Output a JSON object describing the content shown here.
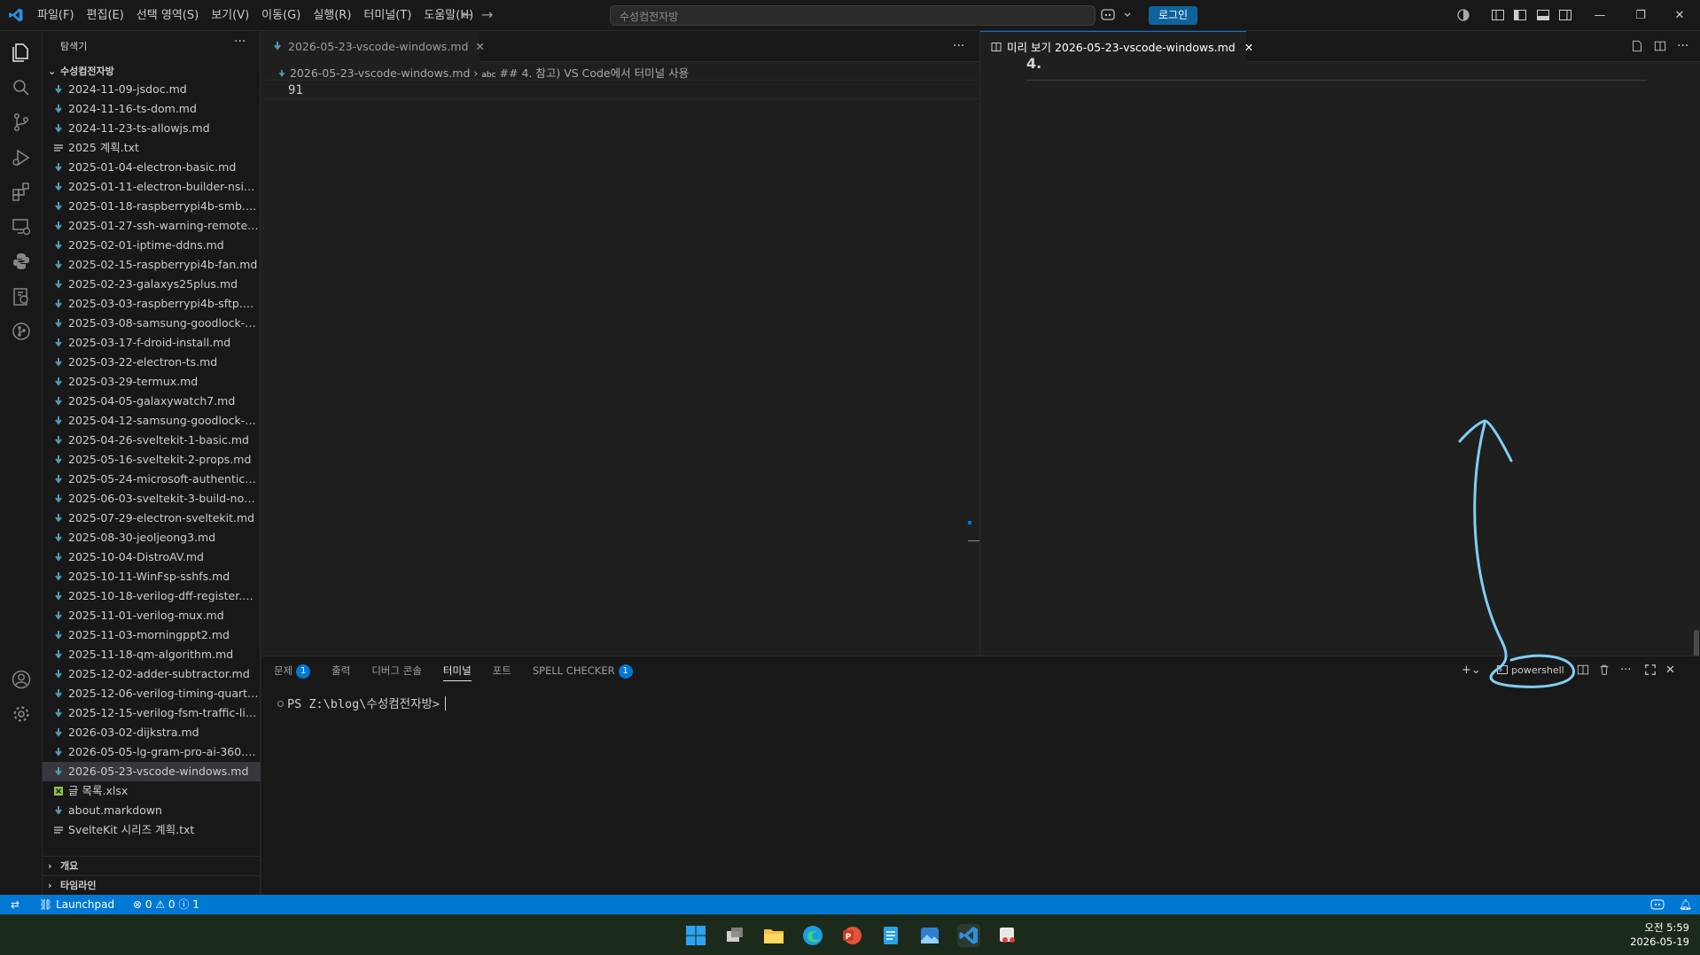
{
  "titlebar": {
    "menu": [
      "파일(F)",
      "편집(E)",
      "선택 영역(S)",
      "보기(V)",
      "이동(G)",
      "실행(R)",
      "터미널(T)",
      "도움말(H)"
    ],
    "search_placeholder": "수성컴전자방",
    "login_label": "로그인"
  },
  "sidebar": {
    "title": "탐색기",
    "folder": "수성컴전자방",
    "files": [
      {
        "name": "2024-11-09-jsdoc.md",
        "type": "md"
      },
      {
        "name": "2024-11-16-ts-dom.md",
        "type": "md"
      },
      {
        "name": "2024-11-23-ts-allowjs.md",
        "type": "md"
      },
      {
        "name": "2025 계획.txt",
        "type": "txt"
      },
      {
        "name": "2025-01-04-electron-basic.md",
        "type": "md"
      },
      {
        "name": "2025-01-11-electron-builder-nsis.md",
        "type": "md"
      },
      {
        "name": "2025-01-18-raspberrypi4b-smb.md",
        "type": "md"
      },
      {
        "name": "2025-01-27-ssh-warning-remote-h...",
        "type": "md"
      },
      {
        "name": "2025-02-01-iptime-ddns.md",
        "type": "md"
      },
      {
        "name": "2025-02-15-raspberrypi4b-fan.md",
        "type": "md"
      },
      {
        "name": "2025-02-23-galaxys25plus.md",
        "type": "md"
      },
      {
        "name": "2025-03-03-raspberrypi4b-sftp.md",
        "type": "md"
      },
      {
        "name": "2025-03-08-samsung-goodlock-mu...",
        "type": "md"
      },
      {
        "name": "2025-03-17-f-droid-install.md",
        "type": "md"
      },
      {
        "name": "2025-03-22-electron-ts.md",
        "type": "md"
      },
      {
        "name": "2025-03-29-termux.md",
        "type": "md"
      },
      {
        "name": "2025-04-05-galaxywatch7.md",
        "type": "md"
      },
      {
        "name": "2025-04-12-samsung-goodlock-ca...",
        "type": "md"
      },
      {
        "name": "2025-04-26-sveltekit-1-basic.md",
        "type": "md"
      },
      {
        "name": "2025-05-16-sveltekit-2-props.md",
        "type": "md"
      },
      {
        "name": "2025-05-24-microsoft-authenticato...",
        "type": "md"
      },
      {
        "name": "2025-06-03-sveltekit-3-build-node....",
        "type": "md"
      },
      {
        "name": "2025-07-29-electron-sveltekit.md",
        "type": "md"
      },
      {
        "name": "2025-08-30-jeoljeong3.md",
        "type": "md"
      },
      {
        "name": "2025-10-04-DistroAV.md",
        "type": "md"
      },
      {
        "name": "2025-10-11-WinFsp-sshfs.md",
        "type": "md"
      },
      {
        "name": "2025-10-18-verilog-dff-register.md",
        "type": "md"
      },
      {
        "name": "2025-11-01-verilog-mux.md",
        "type": "md"
      },
      {
        "name": "2025-11-03-morningppt2.md",
        "type": "md"
      },
      {
        "name": "2025-11-18-qm-algorithm.md",
        "type": "md"
      },
      {
        "name": "2025-12-02-adder-subtractor.md",
        "type": "md"
      },
      {
        "name": "2025-12-06-verilog-timing-quartus....",
        "type": "md"
      },
      {
        "name": "2025-12-15-verilog-fsm-traffic-light...",
        "type": "md"
      },
      {
        "name": "2026-03-02-dijkstra.md",
        "type": "md"
      },
      {
        "name": "2026-05-05-lg-gram-pro-ai-360.md",
        "type": "md"
      },
      {
        "name": "2026-05-23-vscode-windows.md",
        "type": "md",
        "selected": true
      },
      {
        "name": "글 목록.xlsx",
        "type": "xlsx"
      },
      {
        "name": "about.markdown",
        "type": "md"
      },
      {
        "name": "SvelteKit 시리즈 계획.txt",
        "type": "txt"
      }
    ],
    "outline_label": "개요",
    "timeline_label": "타임라인"
  },
  "editor": {
    "tab_label": "2026-05-23-vscode-windows.md",
    "breadcrumb_file": "2026-05-23-vscode-windows.md",
    "breadcrumb_symbol": "## 4. 참고) VS Code에서 터미널 사용",
    "line_number": "91"
  },
  "preview": {
    "tab_label": "미리 보기 2026-05-23-vscode-windows.md",
    "heading": "4."
  },
  "panel": {
    "tabs": [
      {
        "label": "문제",
        "badge": "1"
      },
      {
        "label": "출력"
      },
      {
        "label": "디버그 콘솔"
      },
      {
        "label": "터미널",
        "active": true
      },
      {
        "label": "포트"
      },
      {
        "label": "SPELL CHECKER",
        "badge": "1"
      }
    ],
    "terminal_prompt": "PS Z:\\blog\\수성컴전자방>",
    "shell_label": "powershell"
  },
  "statusbar": {
    "launchpad": "Launchpad",
    "errors": "0",
    "warnings": "0",
    "info": "1",
    "accent": "#0078d4"
  },
  "taskbar": {
    "time": "오전 5:59",
    "date": "2026-05-19"
  }
}
